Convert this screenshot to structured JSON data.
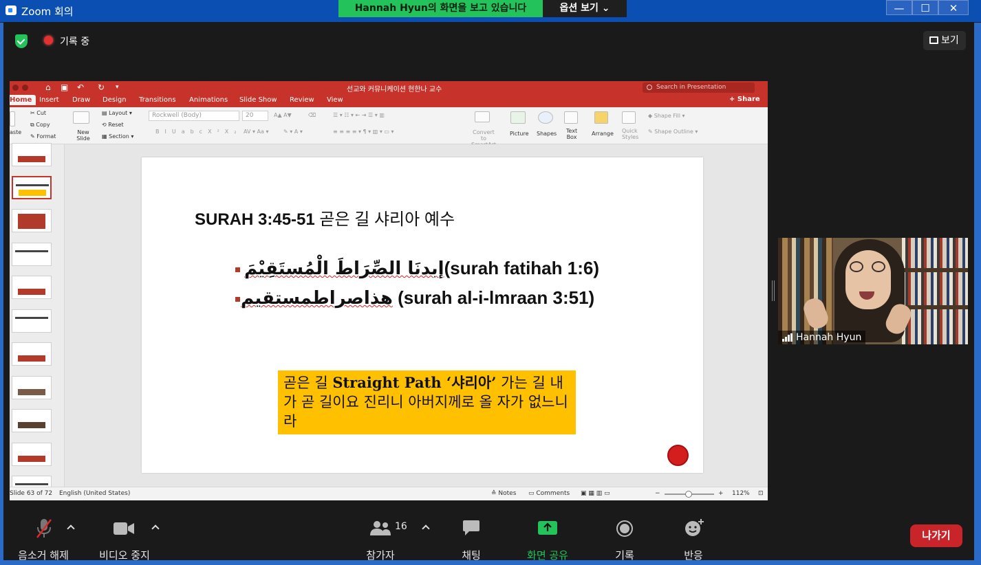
{
  "window": {
    "title": "Zoom 회의",
    "minimize": "—",
    "maximize": "☐",
    "close": "✕"
  },
  "banner": {
    "viewing_text": "Hannah Hyun의 화면을 보고 있습니다",
    "options_label": "옵션 보기 ⌄"
  },
  "meeting": {
    "recording_label": "기록 중",
    "view_label": "보기"
  },
  "powerpoint": {
    "doc_title": "선교와 커뮤니케이션 현한나 교수",
    "search_placeholder": "Search in Presentation",
    "tabs": [
      "Home",
      "Insert",
      "Draw",
      "Design",
      "Transitions",
      "Animations",
      "Slide Show",
      "Review",
      "View"
    ],
    "share_label": "Share",
    "ribbon": {
      "paste": "aste",
      "cut": "Cut",
      "copy": "Copy",
      "format": "Format",
      "new_slide": "New Slide",
      "layout": "Layout",
      "reset": "Reset",
      "section": "Section",
      "font_name": "Rockwell (Body)",
      "font_size": "20",
      "convert_smartart": "Convert to SmartArt",
      "picture": "Picture",
      "shapes": "Shapes",
      "text_box": "Text Box",
      "arrange": "Arrange",
      "quick_styles": "Quick Styles",
      "shape_fill": "Shape Fill",
      "shape_outline": "Shape Outline"
    },
    "slide": {
      "title_bold": "SURAH 3:45-51",
      "title_rest": " 곧은 길 샤리아 예수",
      "bullet1_arabic": "إبدنَا الصِّرَاطَ الْمُستَقِيْمَ",
      "bullet1_latin": "(surah fatihah 1:6)",
      "bullet2_arabic": "هذاصراطمستقيم",
      "bullet2_latin": " (surah al-i-lmraan 3:51)",
      "callout_pre": "곧은 길 ",
      "callout_bold": "Straight Path ‘샤리아’",
      "callout_rest": " 가는 길 내가 곧 길이요 진리니 아버지께로 올 자가 없느니라"
    },
    "status": {
      "slide_of": "Slide 63 of 72",
      "language": "English (United States)",
      "notes": "Notes",
      "comments": "Comments",
      "zoom": "112%"
    }
  },
  "participant": {
    "name": "Hannah Hyun"
  },
  "toolbar": {
    "unmute": "음소거 해제",
    "stop_video": "비디오 중지",
    "participants": "참가자",
    "participant_count": "16",
    "chat": "채팅",
    "share_screen": "화면 공유",
    "record": "기록",
    "reactions": "반응",
    "leave": "나가기"
  },
  "colors": {
    "zoom_green": "#23c25a",
    "ppt_red": "#c7322a",
    "leave_red": "#c8242a",
    "callout_yellow": "#ffc000"
  }
}
